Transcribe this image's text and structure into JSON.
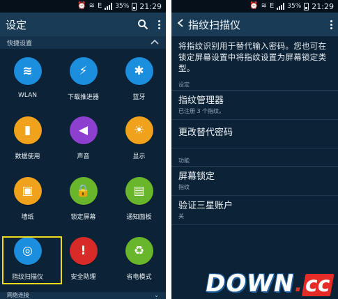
{
  "left": {
    "status": {
      "time": "21:29",
      "battery": "35%",
      "net": "E"
    },
    "appbar": {
      "title": "设定"
    },
    "section_quick": "快捷设置",
    "tiles": [
      {
        "label": "WLAN",
        "icon": "wifi-icon",
        "color": "#1c8ede",
        "glyph": "≋"
      },
      {
        "label": "下载推进器",
        "icon": "download-booster-icon",
        "color": "#1c8ede",
        "glyph": "⚡"
      },
      {
        "label": "蓝牙",
        "icon": "bluetooth-icon",
        "color": "#1c8ede",
        "glyph": "✱"
      },
      {
        "label": "数据使用",
        "icon": "data-usage-icon",
        "color": "#f0a21c",
        "glyph": "▮"
      },
      {
        "label": "声音",
        "icon": "sound-icon",
        "color": "#8d3fd0",
        "glyph": "◀"
      },
      {
        "label": "显示",
        "icon": "display-icon",
        "color": "#f0a21c",
        "glyph": "☀"
      },
      {
        "label": "墙纸",
        "icon": "wallpaper-icon",
        "color": "#f0a21c",
        "glyph": "▣"
      },
      {
        "label": "锁定屏幕",
        "icon": "lock-screen-icon",
        "color": "#69b52b",
        "glyph": "🔒"
      },
      {
        "label": "通知面板",
        "icon": "notification-panel-icon",
        "color": "#69b52b",
        "glyph": "▤"
      },
      {
        "label": "指纹扫描仪",
        "icon": "fingerprint-icon",
        "color": "#1c8ede",
        "glyph": "◎"
      },
      {
        "label": "安全助理",
        "icon": "safety-assistance-icon",
        "color": "#d92a2a",
        "glyph": "!"
      },
      {
        "label": "省电模式",
        "icon": "power-saving-icon",
        "color": "#69b52b",
        "glyph": "♻"
      }
    ],
    "section_network": "网络连接"
  },
  "right": {
    "status": {
      "time": "21:29",
      "battery": "35%",
      "net": "E"
    },
    "appbar": {
      "title": "指纹扫描仪"
    },
    "description": "将指纹识别用于替代输入密码。您也可在锁定屏幕设置中将指纹设置为屏幕锁定类型。",
    "section_settings": "设定",
    "items_settings": [
      {
        "title": "指纹管理器",
        "subtitle": "已注册 3 个指纹。"
      },
      {
        "title": "更改替代密码",
        "subtitle": ""
      }
    ],
    "section_functions": "功能",
    "items_functions": [
      {
        "title": "屏幕锁定",
        "subtitle": "指纹"
      },
      {
        "title": "验证三星账户",
        "subtitle": "关"
      }
    ]
  },
  "watermark": {
    "main": "DOWN",
    "dot": ".",
    "cc": "cc"
  }
}
